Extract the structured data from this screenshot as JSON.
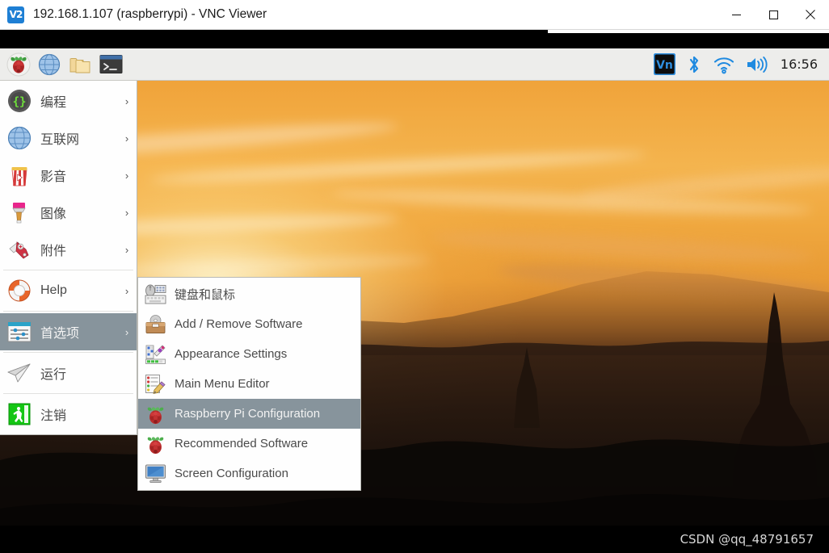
{
  "window": {
    "title": "192.168.1.107 (raspberrypi) - VNC Viewer",
    "logo_text": "V2",
    "logo_icon": "vnc-logo-icon",
    "controls": [
      {
        "name": "minimize-button",
        "icon": "minimize-icon",
        "label": "Minimize"
      },
      {
        "name": "maximize-button",
        "icon": "maximize-icon",
        "label": "Maximize"
      },
      {
        "name": "close-button",
        "icon": "close-icon",
        "label": "Close"
      }
    ]
  },
  "panel": {
    "launchers": [
      {
        "name": "menu-button",
        "icon": "raspberry-logo-icon",
        "label": "Menu"
      },
      {
        "name": "web-browser-launcher",
        "icon": "globe-icon",
        "label": "Web Browser"
      },
      {
        "name": "file-manager-launcher",
        "icon": "folder-icon",
        "label": "File Manager"
      },
      {
        "name": "terminal-launcher",
        "icon": "terminal-icon",
        "label": "Terminal"
      }
    ],
    "tray": [
      {
        "name": "vnc-server-tray-icon",
        "icon": "vnc-icon",
        "label": "VNC Server"
      },
      {
        "name": "bluetooth-tray-icon",
        "icon": "bluetooth-icon",
        "label": "Bluetooth"
      },
      {
        "name": "wifi-tray-icon",
        "icon": "wifi-icon",
        "label": "Wireless Network"
      },
      {
        "name": "volume-tray-icon",
        "icon": "speaker-icon",
        "label": "Volume"
      }
    ],
    "clock": "16:56"
  },
  "main_menu": {
    "items": [
      {
        "label": "编程",
        "icon": "programming-icon",
        "arrow": "›",
        "selected": false,
        "has_submenu": true
      },
      {
        "label": "互联网",
        "icon": "internet-globe-icon",
        "arrow": "›",
        "selected": false,
        "has_submenu": true
      },
      {
        "label": "影音",
        "icon": "sound-video-icon",
        "arrow": "›",
        "selected": false,
        "has_submenu": true
      },
      {
        "label": "图像",
        "icon": "graphics-paintbrush-icon",
        "arrow": "›",
        "selected": false,
        "has_submenu": true
      },
      {
        "label": "附件",
        "icon": "accessories-knife-icon",
        "arrow": "›",
        "selected": false,
        "has_submenu": true
      },
      {
        "label": "Help",
        "icon": "help-lifebuoy-icon",
        "arrow": "›",
        "selected": false,
        "has_submenu": true
      },
      {
        "label": "首选项",
        "icon": "preferences-icon",
        "arrow": "›",
        "selected": true,
        "has_submenu": true
      },
      {
        "label": "运行",
        "icon": "run-paperplane-icon",
        "arrow": "",
        "selected": false,
        "has_submenu": false
      },
      {
        "label": "注销",
        "icon": "logout-icon",
        "arrow": "",
        "selected": false,
        "has_submenu": false
      }
    ]
  },
  "sub_menu": {
    "items": [
      {
        "label": "键盘和鼠标",
        "icon": "keyboard-mouse-icon",
        "selected": false
      },
      {
        "label": "Add / Remove Software",
        "icon": "add-remove-software-icon",
        "selected": false
      },
      {
        "label": "Appearance Settings",
        "icon": "appearance-settings-icon",
        "selected": false
      },
      {
        "label": "Main Menu Editor",
        "icon": "main-menu-editor-icon",
        "selected": false
      },
      {
        "label": "Raspberry Pi Configuration",
        "icon": "raspberry-pi-config-icon",
        "selected": true
      },
      {
        "label": "Recommended Software",
        "icon": "recommended-software-icon",
        "selected": false
      },
      {
        "label": "Screen Configuration",
        "icon": "screen-configuration-icon",
        "selected": false
      }
    ]
  },
  "desktop": {
    "watermark": "CSDN @qq_48791657",
    "wallpaper_description": "Bagan temples at sunset"
  },
  "colors": {
    "menu_highlight": "#87949c",
    "panel_background": "#ededeb",
    "menu_background": "#fefefe",
    "accent_blue": "#1e7fd4",
    "sky_orange": "#f0a33a"
  }
}
